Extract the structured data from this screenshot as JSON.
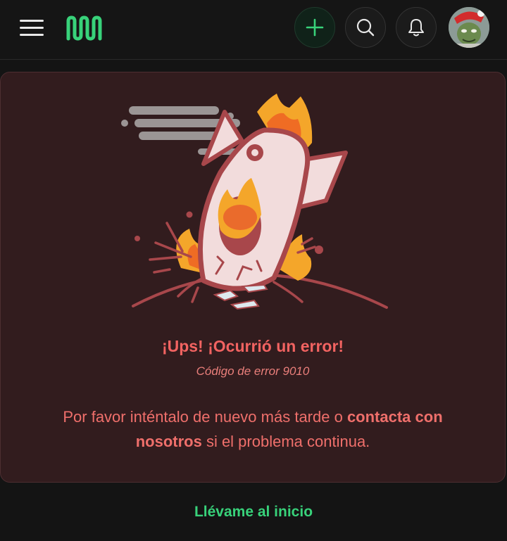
{
  "header": {
    "logo_icon": "wavy-m-logo",
    "add_icon": "plus-icon",
    "search_icon": "search-icon",
    "bell_icon": "bell-icon",
    "avatar_icon": "user-avatar",
    "accent_color": "#38d27a"
  },
  "error": {
    "illustration": "crashed-rocket-illustration",
    "title": "¡Ups! ¡Ocurrió un error!",
    "code": "Código de error 9010",
    "message_pre": "Por favor inténtalo de nuevo más tarde o ",
    "contact_link": "contacta con nosotros",
    "message_post": " si el problema continua.",
    "text_color": "#f26361",
    "card_color": "#321c1e"
  },
  "footer": {
    "home_link": "Llévame al inicio"
  }
}
